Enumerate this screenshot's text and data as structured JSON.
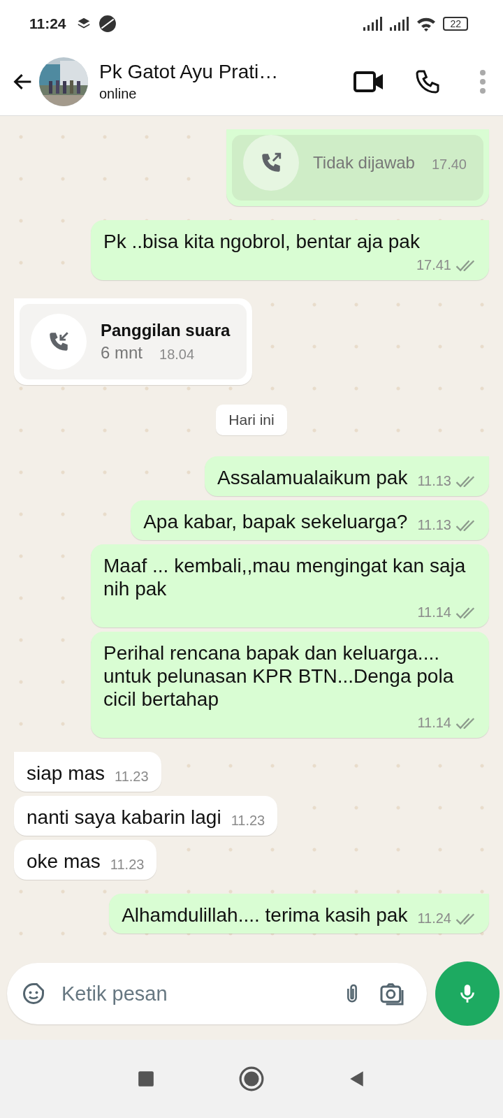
{
  "status_bar": {
    "time": "11:24",
    "battery": "22"
  },
  "header": {
    "name": "Pk Gatot Ayu Prati…",
    "status": "online"
  },
  "messages": [
    {
      "kind": "call",
      "outgoing": true,
      "detail": "Tidak dijawab",
      "time": "17.40"
    },
    {
      "kind": "text",
      "outgoing": true,
      "text": "Pk ..bisa kita ngobrol, bentar aja pak",
      "time": "17.41",
      "read": false,
      "tail": true
    },
    {
      "kind": "call",
      "outgoing": false,
      "title": "Panggilan suara",
      "detail": "6 mnt",
      "time": "18.04"
    },
    {
      "kind": "date",
      "text": "Hari ini"
    },
    {
      "kind": "text",
      "outgoing": true,
      "text": "Assalamualaikum pak",
      "time": "11.13",
      "read": false,
      "tail": true
    },
    {
      "kind": "text",
      "outgoing": true,
      "text": "Apa kabar, bapak sekeluarga?",
      "time": "11.13",
      "read": false,
      "tail": false
    },
    {
      "kind": "text",
      "outgoing": true,
      "text": "Maaf ... kembali,,mau mengingat kan saja nih pak",
      "time": "11.14",
      "read": false,
      "tail": false
    },
    {
      "kind": "text",
      "outgoing": true,
      "text": "Perihal rencana bapak dan keluarga.... untuk pelunasan KPR BTN...Denga pola cicil bertahap",
      "time": "11.14",
      "read": false,
      "tail": false
    },
    {
      "kind": "text",
      "outgoing": false,
      "text": "siap mas",
      "time": "11.23",
      "tail": true
    },
    {
      "kind": "text",
      "outgoing": false,
      "text": "nanti saya kabarin lagi",
      "time": "11.23",
      "tail": false
    },
    {
      "kind": "text",
      "outgoing": false,
      "text": "oke mas",
      "time": "11.23",
      "tail": false
    },
    {
      "kind": "text",
      "outgoing": true,
      "text": "Alhamdulillah.... terima kasih pak",
      "time": "11.24",
      "read": false,
      "tail": true
    }
  ],
  "composer": {
    "placeholder": "Ketik pesan"
  }
}
